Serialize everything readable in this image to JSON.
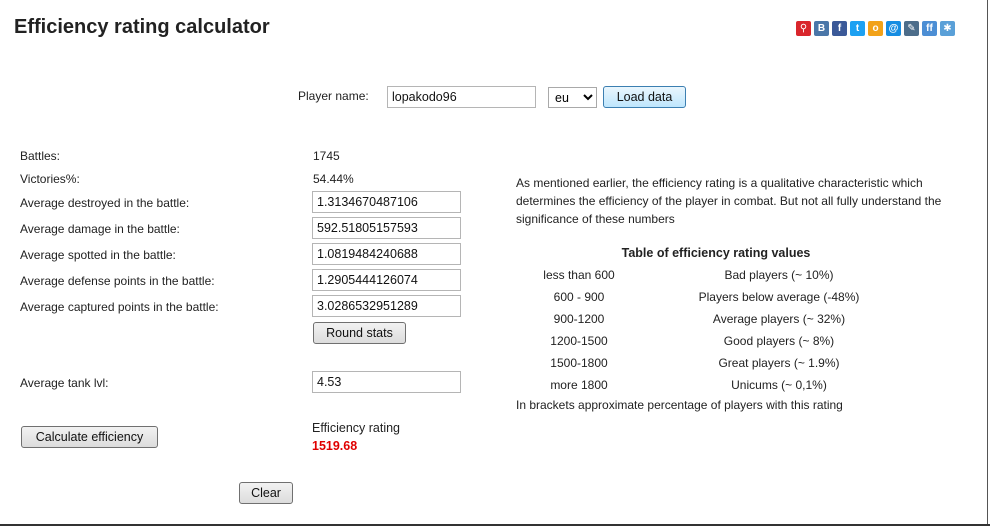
{
  "page": {
    "title": "Efficiency rating calculator"
  },
  "share_icons": [
    {
      "name": "running-man-icon",
      "color": "#d9262c",
      "glyph": "⚲"
    },
    {
      "name": "vk-icon",
      "color": "#4a76a8",
      "glyph": "B"
    },
    {
      "name": "facebook-icon",
      "color": "#3b5998",
      "glyph": "f"
    },
    {
      "name": "twitter-icon",
      "color": "#1da1f2",
      "glyph": "t"
    },
    {
      "name": "odnoklassniki-icon",
      "color": "#f2a219",
      "glyph": "o"
    },
    {
      "name": "mailru-icon",
      "color": "#168de2",
      "glyph": "@"
    },
    {
      "name": "livejournal-icon",
      "color": "#4d6d8a",
      "glyph": "✎"
    },
    {
      "name": "friendfeed-icon",
      "color": "#4c8ed4",
      "glyph": "ff"
    },
    {
      "name": "more-icon",
      "color": "#5aa0d8",
      "glyph": "✱"
    }
  ],
  "player": {
    "label": "Player name:",
    "value": "lopakodo96",
    "server": "eu",
    "servers": [
      "eu"
    ],
    "load_label": "Load data"
  },
  "stats": {
    "battles_label": "Battles:",
    "battles_value": "1745",
    "victories_label": "Victories%:",
    "victories_value": "54.44%",
    "destroyed_label": "Average destroyed in the battle:",
    "destroyed_value": "1.3134670487106",
    "damage_label": "Average damage in the battle:",
    "damage_value": "592.51805157593",
    "spotted_label": "Average spotted in the battle:",
    "spotted_value": "1.0819484240688",
    "defense_label": "Average defense points in the battle:",
    "defense_value": "1.2905444126074",
    "captured_label": "Average captured points in the battle:",
    "captured_value": "3.0286532951289",
    "round_label": "Round stats",
    "tank_label": "Average tank lvl:",
    "tank_value": "4.53"
  },
  "calc": {
    "button_label": "Calculate efficiency",
    "result_label": "Efficiency rating",
    "result_value": "1519.68",
    "clear_label": "Clear",
    "result_color": "#e00000"
  },
  "info": {
    "text": "As mentioned earlier, the efficiency rating is a qualitative characteristic which determines the efficiency of the player in combat. But not all fully understand the significance of these numbers",
    "table_title": "Table of efficiency rating values",
    "rows": [
      {
        "range": "less than 600",
        "desc": "Bad players (~ 10%)"
      },
      {
        "range": "600 - 900",
        "desc": "Players below average (-48%)"
      },
      {
        "range": "900-1200",
        "desc": "Average players (~ 32%)"
      },
      {
        "range": "1200-1500",
        "desc": "Good players (~ 8%)"
      },
      {
        "range": "1500-1800",
        "desc": "Great players (~ 1.9%)"
      },
      {
        "range": "more 1800",
        "desc": "Unicums (~ 0,1%)"
      }
    ],
    "note": "In brackets approximate percentage of players with this rating"
  }
}
